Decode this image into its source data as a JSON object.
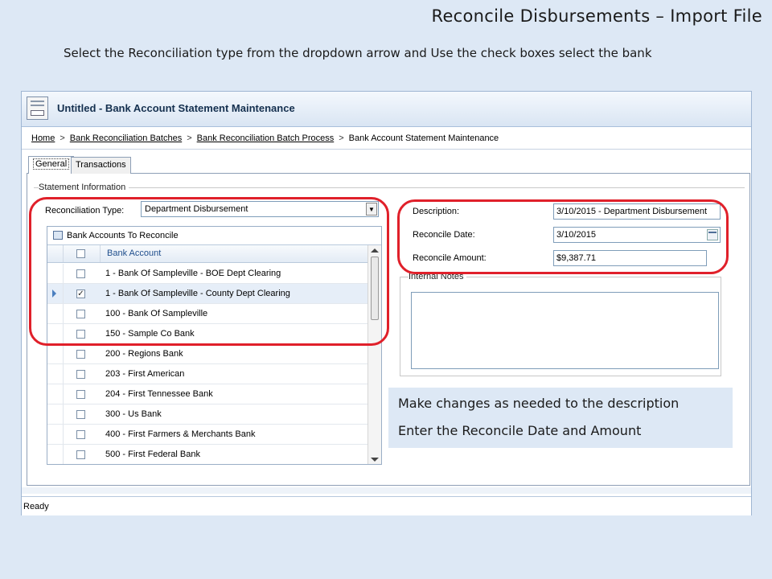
{
  "slide": {
    "title": "Reconcile Disbursements – Import File",
    "instruction": "Select the Reconciliation type from the dropdown arrow and Use the check boxes select the bank"
  },
  "window": {
    "title": "Untitled - Bank Account Statement Maintenance"
  },
  "breadcrumb": {
    "items": [
      "Home",
      "Bank Reconciliation Batches",
      "Bank Reconciliation Batch Process",
      "Bank Account Statement Maintenance"
    ],
    "separator": ">"
  },
  "tabs": [
    "General",
    "Transactions"
  ],
  "statement_info": {
    "group_label": "Statement Information",
    "reconciliation_type_label": "Reconciliation Type:",
    "reconciliation_type_value": "Department Disbursement"
  },
  "bank_grid": {
    "caption": "Bank Accounts To Reconcile",
    "column_header": "Bank Account",
    "rows": [
      {
        "label": "1 - Bank Of Sampleville - BOE Dept Clearing",
        "checked": false
      },
      {
        "label": "1 - Bank Of Sampleville - County Dept Clearing",
        "checked": true
      },
      {
        "label": "100 - Bank Of Sampleville",
        "checked": false
      },
      {
        "label": "150 - Sample Co Bank",
        "checked": false
      },
      {
        "label": "200 - Regions Bank",
        "checked": false
      },
      {
        "label": "203 - First American",
        "checked": false
      },
      {
        "label": "204 - First Tennessee Bank",
        "checked": false
      },
      {
        "label": "300 - Us Bank",
        "checked": false
      },
      {
        "label": "400 - First Farmers & Merchants Bank",
        "checked": false
      },
      {
        "label": "500 - First Federal Bank",
        "checked": false
      }
    ],
    "selected_row": 1
  },
  "details": {
    "description_label": "Description:",
    "description_value": "3/10/2015 - Department Disbursement",
    "reconcile_date_label": "Reconcile Date:",
    "reconcile_date_value": "3/10/2015",
    "reconcile_amount_label": "Reconcile Amount:",
    "reconcile_amount_value": "$9,387.71",
    "internal_notes_label": "Internal Notes",
    "internal_notes_value": ""
  },
  "callout": {
    "line1": "Make changes as needed to the description",
    "line2": "Enter the Reconcile Date and Amount"
  },
  "status": {
    "text": "Ready"
  },
  "colors": {
    "highlight_oval": "#e0202a",
    "background": "#dde8f5",
    "header_text": "#1f4e8c"
  }
}
